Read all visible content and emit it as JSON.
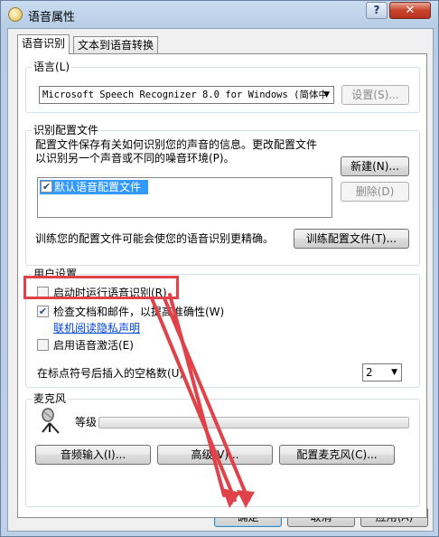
{
  "window": {
    "title": "语音属性",
    "help_label": "?",
    "close_label": "✕"
  },
  "tabs": [
    {
      "label": "语音识别",
      "active": true
    },
    {
      "label": "文本到语音转换",
      "active": false
    }
  ],
  "language_group": {
    "title": "语言(L)",
    "select_value": "Microsoft Speech Recognizer 8.0 for Windows (简体中",
    "settings_button": "设置(S)..."
  },
  "profile_group": {
    "title": "识别配置文件",
    "description_line1": "配置文件保存有关如何识别您的声音的信息。更改配置文件",
    "description_line2": "以识别另一个声音或不同的噪音环境(P)。",
    "new_button": "新建(N)...",
    "delete_button": "删除(D)",
    "profiles": [
      {
        "label": "默认语音配置文件",
        "checked": true,
        "selected": true
      }
    ],
    "train_text": "训练您的配置文件可能会使您的语音识别更精确。",
    "train_button": "训练配置文件(T)..."
  },
  "user_settings": {
    "title": "用户设置",
    "run_at_startup": {
      "label": "启动时运行语音识别(R)",
      "checked": false
    },
    "review_documents": {
      "label": "检查文档和邮件，以提高准确性(W)",
      "checked": true
    },
    "privacy_link": "联机阅读隐私声明",
    "voice_activation": {
      "label": "启用语音激活(E)",
      "checked": false
    },
    "spaces_label": "在标点符号后插入的空格数(U)",
    "spaces_value": "2"
  },
  "microphone": {
    "title": "麦克风",
    "level_label": "等级",
    "level_fraction": 0,
    "audio_input_button": "音频输入(I)...",
    "advanced_button": "高级(V)...",
    "configure_button": "配置麦克风(C)..."
  },
  "footer": {
    "ok_button": "确定",
    "cancel_button": "取消",
    "apply_button": "应用(A)"
  },
  "colors": {
    "annotation": "#e0424a"
  }
}
